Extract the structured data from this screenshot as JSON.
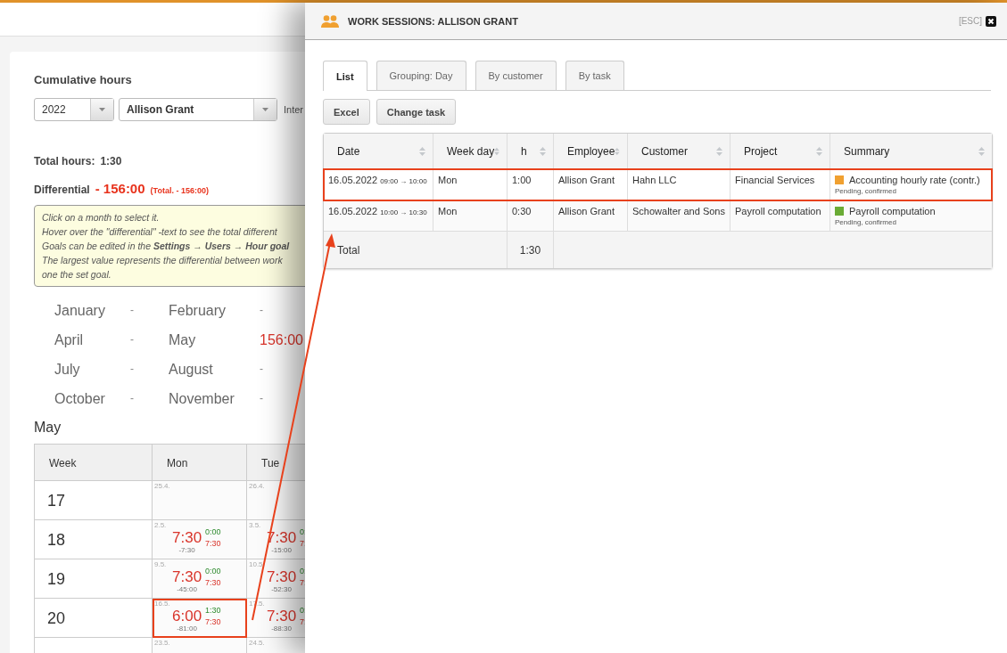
{
  "report": {
    "title": "Cumulative hours",
    "year": "2022",
    "employee": "Allison Grant",
    "interval_label": "Inter",
    "total_label": "Total hours:",
    "total_value": "1:30",
    "differential_label": "Differential",
    "differential_value": "- 156:00",
    "differential_total": "(Total. - 156:00)",
    "info_lines": [
      "Click on a month to select it.",
      "Hover over the \"differential\" -text to see the total different",
      "Goals can be edited in the **Settings** → **Users** → **Hour goal**",
      "The largest value represents the differential between work",
      "one the set goal."
    ],
    "months": [
      {
        "name": "January",
        "value": "-",
        "selected": false
      },
      {
        "name": "February",
        "value": "-",
        "selected": false
      },
      {
        "name": "April",
        "value": "-",
        "selected": false
      },
      {
        "name": "May",
        "value": "156:00",
        "selected": true
      },
      {
        "name": "July",
        "value": "-",
        "selected": false
      },
      {
        "name": "August",
        "value": "-",
        "selected": false
      },
      {
        "name": "October",
        "value": "-",
        "selected": false
      },
      {
        "name": "November",
        "value": "-",
        "selected": false
      }
    ],
    "calendar": {
      "title": "May",
      "columns": [
        "Week",
        "Mon",
        "Tue"
      ],
      "weeks": [
        {
          "week": "17",
          "days": [
            {
              "date": "25.4.",
              "highlighted": false
            },
            {
              "date": "26.4.",
              "highlighted": false
            }
          ]
        },
        {
          "week": "18",
          "days": [
            {
              "date": "2.5.",
              "hours": "7:30",
              "worked": "0:00",
              "goal": "7:30",
              "balance": "-7:30",
              "highlighted": false
            },
            {
              "date": "3.5.",
              "hours": "7:30",
              "worked": "0:",
              "goal": "7:",
              "balance": "-15:00",
              "highlighted": false
            }
          ]
        },
        {
          "week": "19",
          "days": [
            {
              "date": "9.5.",
              "hours": "7:30",
              "worked": "0:00",
              "goal": "7:30",
              "balance": "-45:00",
              "highlighted": false
            },
            {
              "date": "10.5.",
              "hours": "7:30",
              "worked": "0:",
              "goal": "7:",
              "balance": "-52:30",
              "highlighted": false
            }
          ]
        },
        {
          "week": "20",
          "days": [
            {
              "date": "16.5.",
              "hours": "6:00",
              "worked": "1:30",
              "goal": "7:30",
              "balance": "-81:00",
              "highlighted": true
            },
            {
              "date": "17.5.",
              "hours": "7:30",
              "worked": "0:",
              "goal": "7:",
              "balance": "-88:30",
              "highlighted": false
            }
          ]
        },
        {
          "days": [
            {
              "date": "23.5.",
              "highlighted": false
            },
            {
              "date": "24.5.",
              "highlighted": false
            }
          ]
        }
      ]
    }
  },
  "dialog": {
    "title": "WORK SESSIONS: ALLISON GRANT",
    "esc_label": "[ESC]",
    "tabs": [
      {
        "label": "List",
        "selected": true
      },
      {
        "label": "Grouping: Day",
        "selected": false
      },
      {
        "label": "By customer",
        "selected": false
      },
      {
        "label": "By task",
        "selected": false
      }
    ],
    "buttons": [
      "Excel",
      "Change task"
    ],
    "table": {
      "columns": [
        "Date",
        "Week day",
        "h",
        "Employee",
        "Customer",
        "Project",
        "Summary"
      ],
      "rows": [
        {
          "date": "16.05.2022",
          "time": "09:00 → 10:00",
          "weekday": "Mon",
          "hours": "1:00",
          "employee": "Allison Grant",
          "customer": "Hahn LLC",
          "project": "Financial Services",
          "task": "Accounting hourly rate (contr.)",
          "color": "#f0a030",
          "status": "Pending, confirmed",
          "highlighted": true
        },
        {
          "date": "16.05.2022",
          "time": "10:00 → 10:30",
          "weekday": "Mon",
          "hours": "0:30",
          "employee": "Allison Grant",
          "customer": "Schowalter and Sons",
          "project": "Payroll computation",
          "task": "Payroll computation",
          "color": "#6aab35",
          "status": "Pending, confirmed",
          "highlighted": false
        }
      ],
      "total_label": "Total",
      "total_hours": "1:30"
    }
  }
}
